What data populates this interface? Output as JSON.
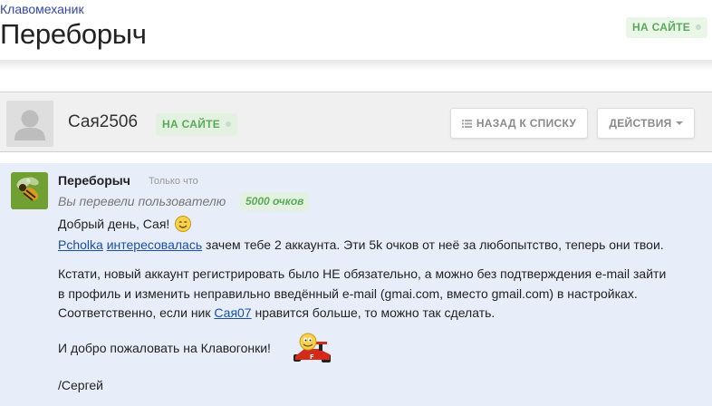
{
  "header": {
    "site_link": "Клавомеханик",
    "title": "Переборыч",
    "status": "НА САЙТЕ"
  },
  "dialog": {
    "username": "Сая2506",
    "status": "НА САЙТЕ",
    "back_button": "НАЗАД К СПИСКУ",
    "actions_button": "ДЕЙСТВИЯ"
  },
  "message": {
    "author": "Переборыч",
    "time": "Только что",
    "transfer_text": "Вы перевели пользователю",
    "points": "5000 очков",
    "greeting": "Добрый день, Сая!",
    "line2": {
      "link1": "Pcholka",
      "link2": "интересовалась",
      "rest": " зачем тебе 2 аккаунта. Эти 5k очков от неё за любопытство, теперь они твои."
    },
    "para2_line1": "Кстати, новый аккаунт регистрировать было НЕ обязательно, а можно без подтверждения e-mail зайти",
    "para2_line2": "в профиль и изменить неправильно введённый e-mail (gmai.com, вместо gmail.com) в настройках.",
    "para2_line3": {
      "before": "Соответственно, если ник ",
      "link": "Сая07",
      "after": " нравится больше, то можно так сделать."
    },
    "welcome": "И добро пожаловать на Клавогонки!",
    "signature": "/Сергей"
  },
  "colors": {
    "online_green": "#5aa95a",
    "link_blue": "#1a4fa8",
    "message_bg": "#e7eef9"
  },
  "icons": [
    "user-silhouette-icon",
    "list-icon",
    "caret-down-icon",
    "bee-avatar-icon",
    "smiley-icon",
    "race-car-smiley-icon"
  ]
}
